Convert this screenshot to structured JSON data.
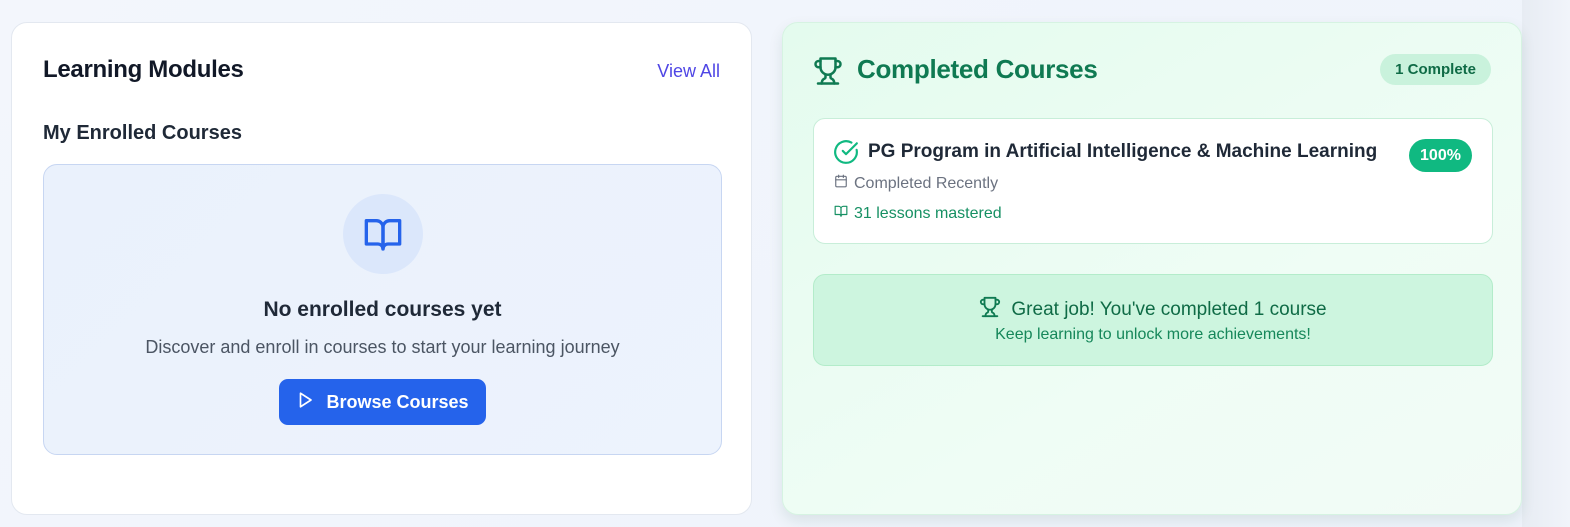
{
  "learning_modules": {
    "title": "Learning Modules",
    "view_all_label": "View All",
    "enrolled_heading": "My Enrolled Courses",
    "empty_state": {
      "icon": "book-open-icon",
      "title": "No enrolled courses yet",
      "description": "Discover and enroll in courses to start your learning journey",
      "browse_button_label": "Browse Courses",
      "browse_button_icon": "play-icon"
    }
  },
  "completed_courses": {
    "title": "Completed Courses",
    "header_icon": "trophy-icon",
    "badge_label": "1 Complete",
    "courses": [
      {
        "name": "PG Program in Artificial Intelligence & Machine Learning",
        "progress_label": "100%",
        "progress": 100,
        "completed_label": "Completed Recently",
        "lessons_label": "31 lessons mastered"
      }
    ],
    "congrats": {
      "headline": "Great job! You've completed 1 course",
      "subtext": "Keep learning to unlock more achievements!"
    }
  },
  "colors": {
    "primary_blue": "#2563eb",
    "accent_green": "#10b981",
    "title_green": "#0f7a52",
    "link_indigo": "#4f46e5"
  }
}
